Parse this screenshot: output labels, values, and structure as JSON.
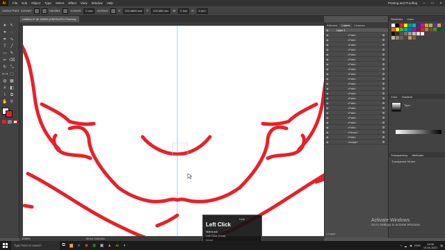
{
  "app": {
    "logo": "Ai",
    "workspace": "Printing and Proofing"
  },
  "menu": [
    "File",
    "Edit",
    "Object",
    "Type",
    "Select",
    "Effect",
    "View",
    "Window",
    "Help"
  ],
  "window_buttons": [
    "–",
    "□",
    "×"
  ],
  "control_bar": {
    "selection": "Anchor Point",
    "label1": "Convert:",
    "label2": "Handles:",
    "corners_label": "Corners:",
    "corners_value": "0 mm",
    "label3": "Anchors:",
    "x": "225.6855 mm",
    "y": "123.586 mm",
    "w": "0 mm",
    "h": "0 mm"
  },
  "document_tab": "Untitled-3* @ 1266% (CMYK/CPU Preview)",
  "layers_panel": {
    "tabs": [
      "Artboard",
      "Layers",
      "Libraries"
    ],
    "active_tab": "Layers",
    "layer_name": "Layer 1",
    "items": [
      "<Path>",
      "<Path>",
      "<Path>",
      "<Path>",
      "<Path>",
      "<Path>",
      "<Path>",
      "<Path>",
      "<Path>",
      "<Path>",
      "<Path>",
      "<Path>",
      "<Path>",
      "<Path>",
      "<Path>",
      "<Path>",
      "<Path>",
      "<Path>",
      "<Path>",
      "<Path>",
      "<Group>",
      "<Path>",
      "<Image>"
    ],
    "footer": "1 Layer"
  },
  "right_panel": {
    "top_tabs": [
      "Swatches",
      "Color"
    ],
    "gradient_tabs": [
      "Color",
      "Gradient"
    ],
    "type_label": "Type:",
    "attr_tabs": [
      "Transparency",
      "Attributes"
    ],
    "transparency_label": "Transparent Stroke"
  },
  "status": {
    "zoom": "1266%",
    "tool": "Direct Selection"
  },
  "tooltip": {
    "key_hint": "Hold",
    "action": "Left Click",
    "modifier": "MainLock",
    "detail": "Left Click (Hold)",
    "extra": "About"
  },
  "activate_windows": {
    "title": "Activate Windows",
    "subtitle": "Go to Settings to activate Windows."
  },
  "taskbar": {
    "search_placeholder": "Type here to search",
    "tray_lang": "ENG",
    "time": "13:06",
    "date": "10-04-2021"
  },
  "colors": {
    "stroke": "#e8202a",
    "guide": "#7ecbf2",
    "panel": "#424242"
  }
}
